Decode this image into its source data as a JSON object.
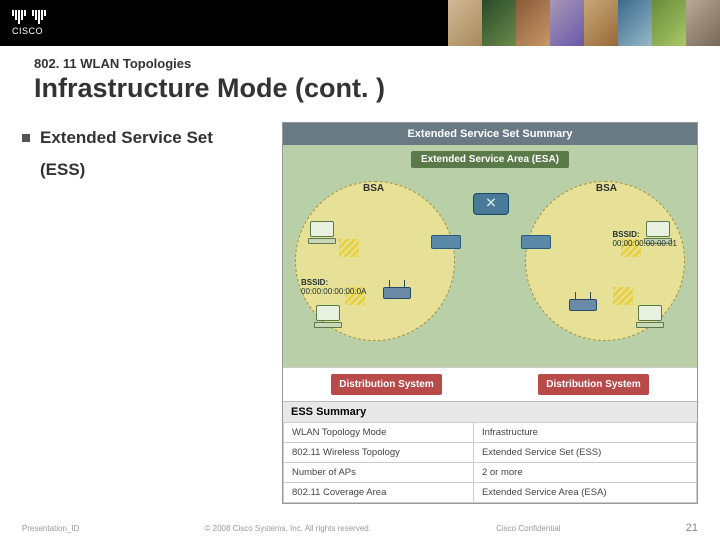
{
  "brand": {
    "name": "CISCO"
  },
  "headings": {
    "kicker": "802. 11 WLAN Topologies",
    "title": "Infrastructure Mode (cont. )"
  },
  "bullet": {
    "line1": "Extended Service Set",
    "line2": "(ESS)"
  },
  "figure": {
    "title": "Extended Service Set Summary",
    "esa": "Extended Service Area (ESA)",
    "bsa": "BSA",
    "bssid_left_label": "BSSID:",
    "bssid_left_value": "00:00:00:00:00:0A",
    "bssid_right_label": "BSSID:",
    "bssid_right_value": "00:00:00:00:00:01",
    "ds": "Distribution System",
    "summary_header": "ESS Summary",
    "rows": [
      {
        "k": "WLAN Topology Mode",
        "v": "Infrastructure"
      },
      {
        "k": "802.11 Wireless Topology",
        "v": "Extended Service Set (ESS)"
      },
      {
        "k": "Number of APs",
        "v": "2 or more"
      },
      {
        "k": "802.11 Coverage Area",
        "v": "Extended Service Area (ESA)"
      }
    ]
  },
  "footer": {
    "left": "Presentation_ID",
    "center": "© 2008 Cisco Systems, Inc. All rights reserved.",
    "right": "Cisco Confidential",
    "page": "21"
  }
}
